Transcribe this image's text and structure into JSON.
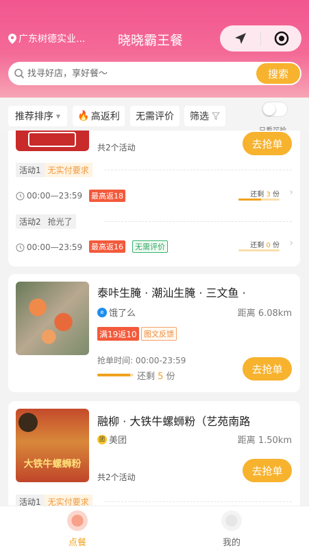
{
  "header": {
    "location": "广东树德实业...",
    "title": "晓晓霸王餐",
    "search_placeholder": "找寻好店，享好餐～",
    "search_button": "搜索"
  },
  "filters": {
    "sort": "推荐排序",
    "high_rebate": "高返利",
    "no_review": "无需评价",
    "filter": "筛选",
    "toggle_label": "只看可抢"
  },
  "card1": {
    "activity_count": "共2个活动",
    "grab_button": "去抢单",
    "activities": [
      {
        "label": "活动1",
        "value": "无实付要求",
        "time": "00:00—23:59",
        "tag": "最高返18",
        "extra_tag": "",
        "remain_prefix": "还剩",
        "remain_count": "3",
        "remain_suffix": "份",
        "progress": 0.55
      },
      {
        "label": "活动2",
        "value": "抢光了",
        "time": "00:00—23:59",
        "tag": "最高返16",
        "extra_tag": "无需评价",
        "remain_prefix": "还剩",
        "remain_count": "0",
        "remain_suffix": "份",
        "progress": 0.0
      }
    ]
  },
  "card2": {
    "name": "泰咔生腌 · 潮汕生腌 · 三文鱼 ·",
    "platform": "饿了么",
    "distance": "距离 6.08km",
    "tag1": "满19返10",
    "tag2": "图文反馈",
    "time_label": "抢单时间: 00:00-23:59",
    "remain_prefix": "还剩",
    "remain_count": "5",
    "remain_suffix": "份",
    "progress": 0.9,
    "grab_button": "去抢单"
  },
  "card3": {
    "name": "融柳 · 大铁牛螺蛳粉（艺苑南路",
    "platform": "美团",
    "distance": "距离 1.50km",
    "activity_count": "共2个活动",
    "grab_button": "去抢单",
    "thumb_text": "大铁牛螺蛳粉",
    "activity1_label": "活动1",
    "activity1_value": "无实付要求"
  },
  "tabbar": {
    "tab1": "点餐",
    "tab2": "我的"
  },
  "colors": {
    "brand_pink": "#f2568f",
    "accent_orange": "#f7b22e",
    "tag_red": "#f35a3b"
  }
}
